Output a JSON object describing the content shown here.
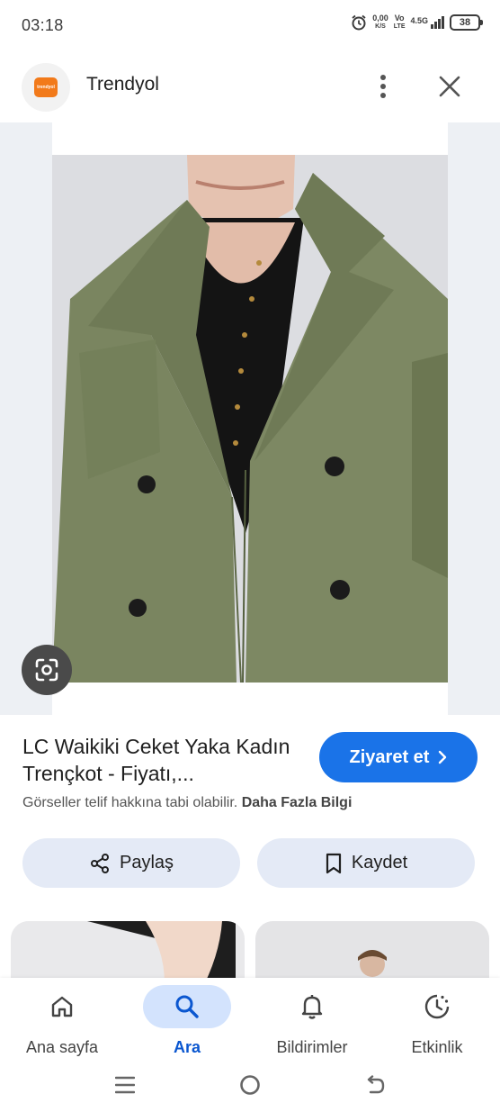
{
  "status_bar": {
    "time": "03:18",
    "net_speed_value": "0,00",
    "net_speed_unit": "K/S",
    "volte_top": "Vo",
    "volte_bottom": "LTE",
    "network": "4.5G",
    "battery": "38",
    "icons": [
      "alarm-icon",
      "signal-icon",
      "battery-icon"
    ]
  },
  "header": {
    "site_name": "Trendyol",
    "logo_text": "trendyol",
    "logo_color": "#f27a1a",
    "icons": [
      "more-vert-icon",
      "close-icon"
    ]
  },
  "result": {
    "title": "LC Waikiki Ceket Yaka Kadın Trençkot - Fiyatı,...",
    "visit_label": "Ziyaret et",
    "copyright_text": "Görseller telif hakkına tabi olabilir.",
    "more_info_label": "Daha Fazla Bilgi",
    "image_subject": "olive trench coat product photo"
  },
  "actions": {
    "share_label": "Paylaş",
    "save_label": "Kaydet"
  },
  "bottom_nav": {
    "items": [
      {
        "label": "Ana sayfa",
        "icon": "home-icon",
        "active": false
      },
      {
        "label": "Ara",
        "icon": "search-icon",
        "active": true
      },
      {
        "label": "Bildirimler",
        "icon": "bell-icon",
        "active": false
      },
      {
        "label": "Etkinlik",
        "icon": "activity-icon",
        "active": false
      }
    ]
  },
  "colors": {
    "accent": "#1a73e8",
    "active_nav_bg": "#d3e3fd",
    "action_button_bg": "#e4eaf6",
    "coat": "#7a8560"
  }
}
